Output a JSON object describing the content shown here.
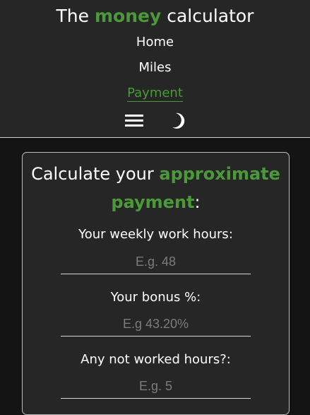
{
  "colors": {
    "accent": "#4a9a3a",
    "header_bg": "#262626",
    "page_bg": "#141414",
    "card_bg": "#262626"
  },
  "header": {
    "title_prefix": "The ",
    "title_accent": "money",
    "title_suffix": " calculator",
    "nav": [
      {
        "label": "Home",
        "active": false
      },
      {
        "label": "Miles",
        "active": false
      },
      {
        "label": "Payment",
        "active": true
      }
    ],
    "menu_icon": "hamburger-icon",
    "theme_icon": "moon-icon"
  },
  "card": {
    "title_prefix": "Calculate your ",
    "title_accent": "approximate payment",
    "title_suffix": ":",
    "fields": [
      {
        "label": "Your weekly work hours:",
        "placeholder": "E.g. 48",
        "value": ""
      },
      {
        "label": "Your bonus %:",
        "placeholder": "E.g 43.20%",
        "value": ""
      },
      {
        "label": "Any not worked hours?:",
        "placeholder": "E.g. 5",
        "value": ""
      }
    ]
  }
}
